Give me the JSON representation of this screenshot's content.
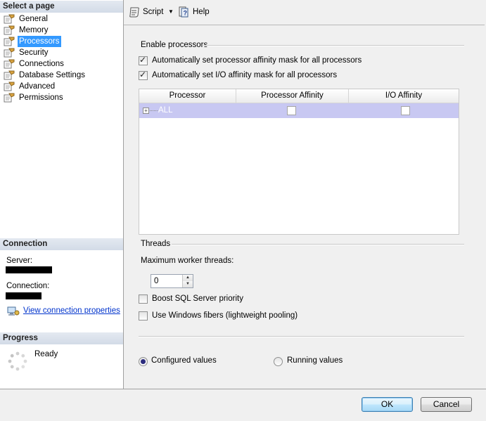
{
  "left_pane": {
    "select_page_title": "Select a page",
    "pages": [
      {
        "label": "General",
        "selected": false
      },
      {
        "label": "Memory",
        "selected": false
      },
      {
        "label": "Processors",
        "selected": true
      },
      {
        "label": "Security",
        "selected": false
      },
      {
        "label": "Connections",
        "selected": false
      },
      {
        "label": "Database Settings",
        "selected": false
      },
      {
        "label": "Advanced",
        "selected": false
      },
      {
        "label": "Permissions",
        "selected": false
      }
    ],
    "connection": {
      "title": "Connection",
      "server_label": "Server:",
      "connection_label": "Connection:",
      "view_properties_link": "View connection properties"
    },
    "progress": {
      "title": "Progress",
      "status": "Ready"
    }
  },
  "toolbar": {
    "script_label": "Script",
    "help_label": "Help"
  },
  "processors": {
    "group_title": "Enable processors",
    "auto_processor_affinity": {
      "label": "Automatically set processor affinity mask for all processors",
      "checked": true
    },
    "auto_io_affinity": {
      "label": "Automatically set I/O affinity mask for all processors",
      "checked": true
    },
    "grid": {
      "columns": [
        "Processor",
        "Processor Affinity",
        "I/O Affinity"
      ],
      "rows": [
        {
          "processor": "ALL",
          "processor_affinity": false,
          "io_affinity": false
        }
      ]
    }
  },
  "threads": {
    "group_title": "Threads",
    "max_worker_label": "Maximum worker threads:",
    "max_worker_value": "0",
    "boost_priority": {
      "label": "Boost SQL Server priority",
      "checked": false
    },
    "windows_fibers": {
      "label": "Use Windows fibers (lightweight pooling)",
      "checked": false
    }
  },
  "values_mode": {
    "configured_label": "Configured  values",
    "running_label": "Running values",
    "selected": "configured"
  },
  "footer": {
    "ok_label": "OK",
    "cancel_label": "Cancel"
  }
}
